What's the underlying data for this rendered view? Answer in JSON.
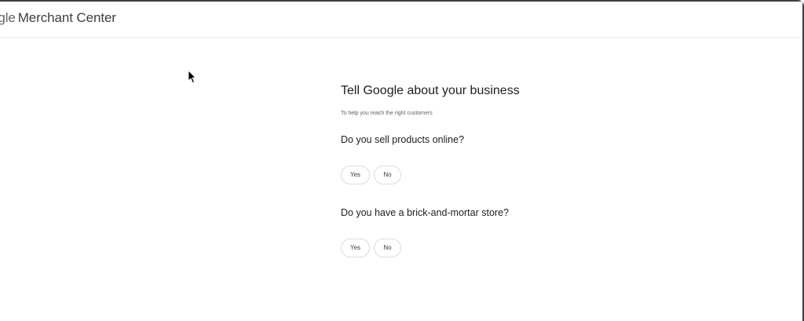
{
  "header": {
    "logo_text": "ogle",
    "product_name": "Merchant Center"
  },
  "onboarding": {
    "title": "Tell Google about your business",
    "subtitle": "To help you reach the right customers",
    "questions": [
      {
        "text": "Do you sell products online?",
        "yes_label": "Yes",
        "no_label": "No"
      },
      {
        "text": "Do you have a brick-and-mortar store?",
        "yes_label": "Yes",
        "no_label": "No"
      }
    ]
  },
  "colors": {
    "text_primary": "#202124",
    "text_secondary": "#5f6368",
    "border": "#dadce0"
  }
}
